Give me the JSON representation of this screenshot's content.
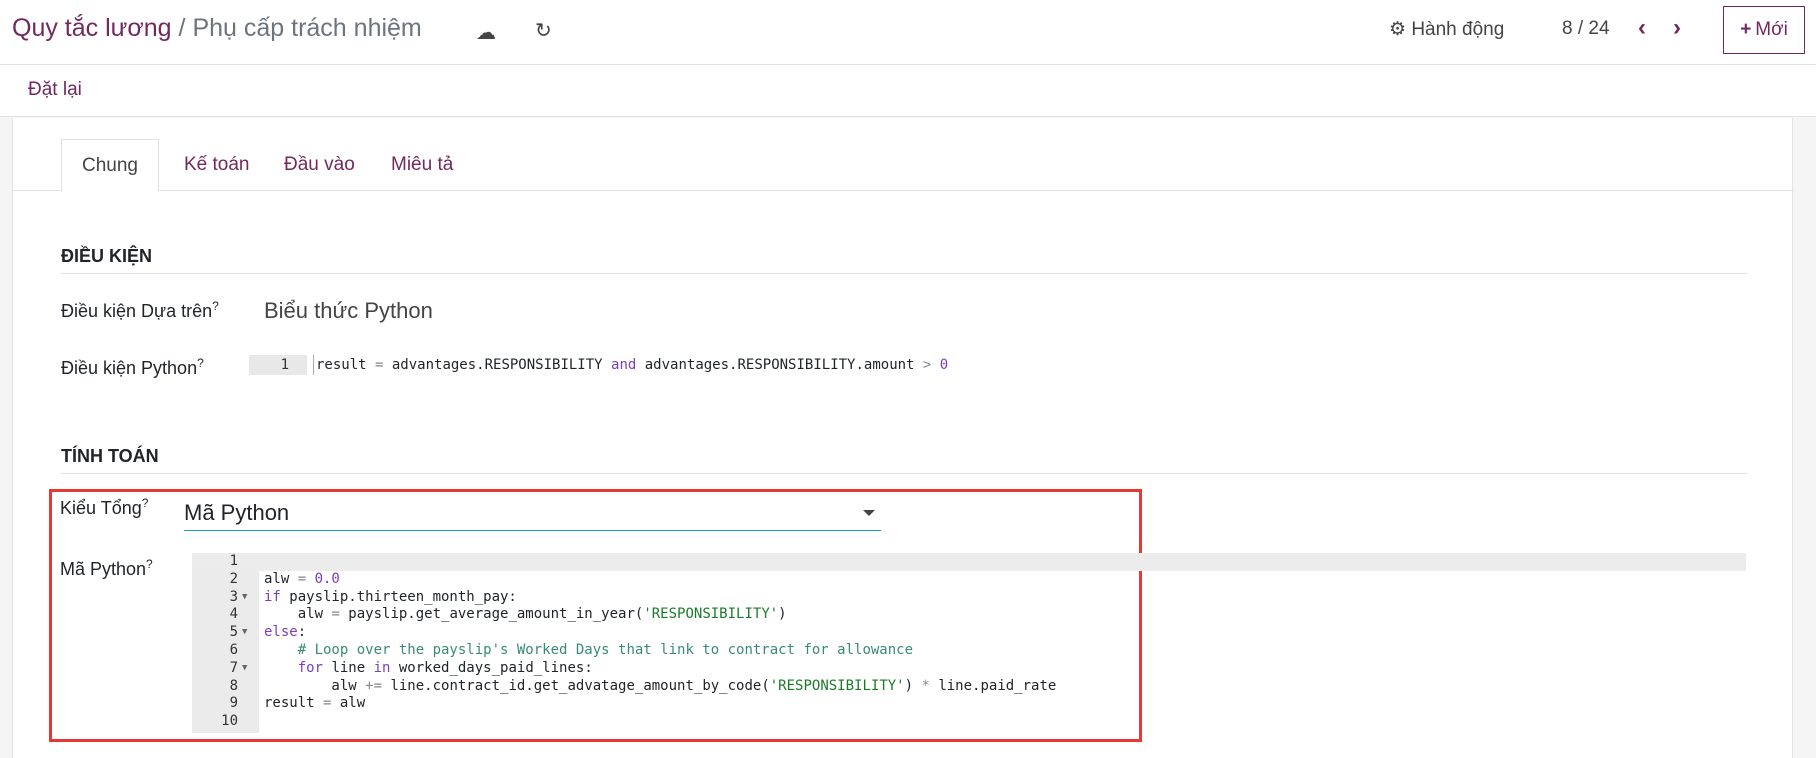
{
  "header": {
    "breadcrumb_root": "Quy tắc lương",
    "separator": "/",
    "record": "Phụ cấp trách nhiệm",
    "actions_label": "Hành động",
    "pager": "8 / 24",
    "new_label": "Mới"
  },
  "toolbar": {
    "reset_label": "Đặt lại"
  },
  "tabs": [
    {
      "label": "Chung"
    },
    {
      "label": "Kế toán"
    },
    {
      "label": "Đầu vào"
    },
    {
      "label": "Miêu tả"
    }
  ],
  "condition": {
    "title": "ĐIỀU KIỆN",
    "based_on_label": "Điều kiện Dựa trên",
    "based_on_value": "Biểu thức Python",
    "python_label": "Điều kiện Python",
    "line_no": "1",
    "code": [
      [
        "result ",
        ""
      ],
      [
        "= ",
        "op"
      ],
      [
        "advantages.RESPONSIBILITY ",
        ""
      ],
      [
        "and",
        "kw"
      ],
      [
        " advantages.RESPONSIBILITY.amount ",
        ""
      ],
      [
        "> ",
        "op"
      ],
      [
        "0",
        "num"
      ]
    ]
  },
  "compute": {
    "title": "TÍNH TOÁN",
    "type_label": "Kiểu Tổng",
    "type_value": "Mã Python",
    "code_label": "Mã Python",
    "lines": [
      {
        "n": "1",
        "fold": false,
        "tokens": []
      },
      {
        "n": "2",
        "fold": false,
        "tokens": [
          [
            "alw ",
            ""
          ],
          [
            "= ",
            "op"
          ],
          [
            "0.0",
            "num"
          ]
        ]
      },
      {
        "n": "3",
        "fold": true,
        "tokens": [
          [
            "if",
            "kw"
          ],
          [
            " payslip.thirteen_month_pay:",
            ""
          ]
        ]
      },
      {
        "n": "4",
        "fold": false,
        "tokens": [
          [
            "    alw ",
            ""
          ],
          [
            "= ",
            "op"
          ],
          [
            "payslip.get_average_amount_in_year(",
            ""
          ],
          [
            "'RESPONSIBILITY'",
            "str"
          ],
          [
            ")",
            ""
          ]
        ]
      },
      {
        "n": "5",
        "fold": true,
        "tokens": [
          [
            "else",
            "kw"
          ],
          [
            ":",
            ""
          ]
        ]
      },
      {
        "n": "6",
        "fold": false,
        "tokens": [
          [
            "    ",
            ""
          ],
          [
            "# Loop over the payslip's Worked Days that link to contract for allowance",
            "cm"
          ]
        ]
      },
      {
        "n": "7",
        "fold": true,
        "tokens": [
          [
            "    ",
            ""
          ],
          [
            "for",
            "kw"
          ],
          [
            " line ",
            ""
          ],
          [
            "in",
            "kw"
          ],
          [
            " worked_days_paid_lines:",
            ""
          ]
        ]
      },
      {
        "n": "8",
        "fold": false,
        "tokens": [
          [
            "        alw ",
            ""
          ],
          [
            "+= ",
            "op"
          ],
          [
            "line.contract_id.get_advatage_amount_by_code(",
            ""
          ],
          [
            "'RESPONSIBILITY'",
            "str"
          ],
          [
            ") ",
            ""
          ],
          [
            "* ",
            "op"
          ],
          [
            "line.paid_rate",
            ""
          ]
        ]
      },
      {
        "n": "9",
        "fold": false,
        "tokens": [
          [
            "result ",
            ""
          ],
          [
            "= ",
            "op"
          ],
          [
            "alw",
            ""
          ]
        ]
      },
      {
        "n": "10",
        "fold": false,
        "tokens": []
      }
    ]
  }
}
